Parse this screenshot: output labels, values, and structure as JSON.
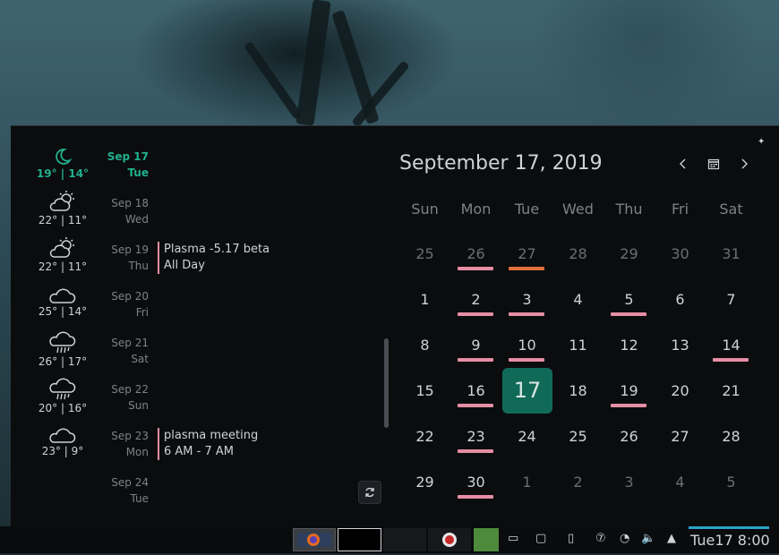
{
  "calendar": {
    "title": "September 17, 2019",
    "weekdays": [
      "Sun",
      "Mon",
      "Tue",
      "Wed",
      "Thu",
      "Fri",
      "Sat"
    ],
    "weeks": [
      [
        "25",
        "26",
        "27",
        "28",
        "29",
        "30",
        "31"
      ],
      [
        "1",
        "2",
        "3",
        "4",
        "5",
        "6",
        "7"
      ],
      [
        "8",
        "9",
        "10",
        "11",
        "12",
        "13",
        "14"
      ],
      [
        "15",
        "16",
        "17",
        "18",
        "19",
        "20",
        "21"
      ],
      [
        "22",
        "23",
        "24",
        "25",
        "26",
        "27",
        "28"
      ],
      [
        "29",
        "30",
        "1",
        "2",
        "3",
        "4",
        "5"
      ]
    ],
    "today": "17",
    "event_color": "#e68ea4",
    "holiday_color": "#e0703a",
    "today_color": "#116a58"
  },
  "weather": [
    {
      "icon": "moon-icon",
      "temp": "19° | 14°"
    },
    {
      "icon": "partly-cloudy-icon",
      "temp": "22° | 11°"
    },
    {
      "icon": "partly-cloudy-icon",
      "temp": "22° | 11°"
    },
    {
      "icon": "cloud-icon",
      "temp": "25° | 14°"
    },
    {
      "icon": "rain-icon",
      "temp": "26° | 17°"
    },
    {
      "icon": "rain-icon",
      "temp": "20° | 16°"
    },
    {
      "icon": "cloud-icon",
      "temp": "23° | 9°"
    }
  ],
  "agenda": [
    {
      "date": "Sep 17",
      "weekday": "Tue"
    },
    {
      "date": "Sep 18",
      "weekday": "Wed"
    },
    {
      "date": "Sep 19",
      "weekday": "Thu",
      "event": "Plasma -5.17 beta",
      "time": "All Day"
    },
    {
      "date": "Sep 20",
      "weekday": "Fri"
    },
    {
      "date": "Sep 21",
      "weekday": "Sat"
    },
    {
      "date": "Sep 22",
      "weekday": "Sun"
    },
    {
      "date": "Sep 23",
      "weekday": "Mon",
      "event": "plasma meeting",
      "time": "6 AM - 7 AM"
    },
    {
      "date": "Sep 24",
      "weekday": "Tue"
    }
  ],
  "taskbar": {
    "clock": "Tue17 8:00",
    "accent": "#2aa3c8"
  }
}
